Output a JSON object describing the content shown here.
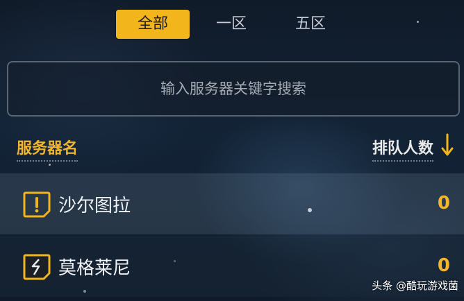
{
  "tabs": [
    {
      "label": "全部",
      "active": true
    },
    {
      "label": "一区",
      "active": false
    },
    {
      "label": "五区",
      "active": false
    }
  ],
  "search": {
    "placeholder": "输入服务器关键字搜索"
  },
  "columns": {
    "name_header": "服务器名",
    "queue_header": "排队人数",
    "sort_icon": "sort-down-arrow-icon"
  },
  "servers": [
    {
      "name": "沙尔图拉",
      "queue": "0",
      "status_icon": "alert-bubble-icon"
    },
    {
      "name": "莫格莱尼",
      "queue": "0",
      "status_icon": "split-bubble-icon"
    }
  ],
  "watermark": "头条 @酷玩游戏菌",
  "colors": {
    "accent": "#f3b51c",
    "background": "#132336"
  }
}
